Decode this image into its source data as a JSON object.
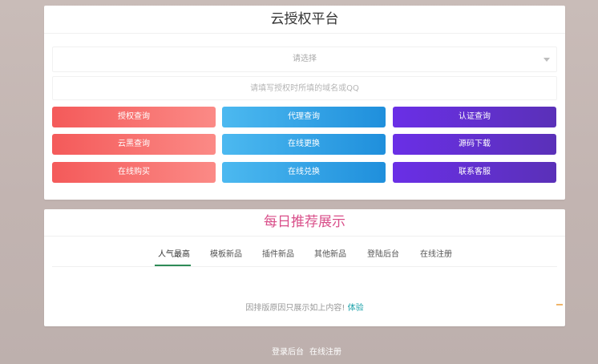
{
  "auth_panel": {
    "title": "云授权平台",
    "select_placeholder": "请选择",
    "domain_placeholder": "请填写授权时所填的域名或QQ",
    "buttons": [
      {
        "label": "授权查询",
        "color": "red"
      },
      {
        "label": "代理查询",
        "color": "blue"
      },
      {
        "label": "认证查询",
        "color": "purple"
      },
      {
        "label": "云黑查询",
        "color": "red"
      },
      {
        "label": "在线更换",
        "color": "blue"
      },
      {
        "label": "源码下载",
        "color": "purple"
      },
      {
        "label": "在线购买",
        "color": "red"
      },
      {
        "label": "在线兑换",
        "color": "blue"
      },
      {
        "label": "联系客服",
        "color": "purple"
      }
    ]
  },
  "recommend_panel": {
    "title": "每日推荐展示",
    "tabs": [
      "人气最高",
      "模板新品",
      "插件新品",
      "其他新品",
      "登陆后台",
      "在线注册"
    ],
    "active_tab": "人气最高",
    "notice_text": "因排版原因只展示如上内容!",
    "notice_link": "体验"
  },
  "footer": {
    "links": [
      "登录后台",
      "在线注册"
    ]
  },
  "colors": {
    "red": "#f45a5a",
    "blue": "#2f9fe6",
    "purple": "#6a2fe6",
    "title_pink": "#d94f8a",
    "tab_active_underline": "#2e8b57",
    "link_teal": "#18a0a8"
  }
}
